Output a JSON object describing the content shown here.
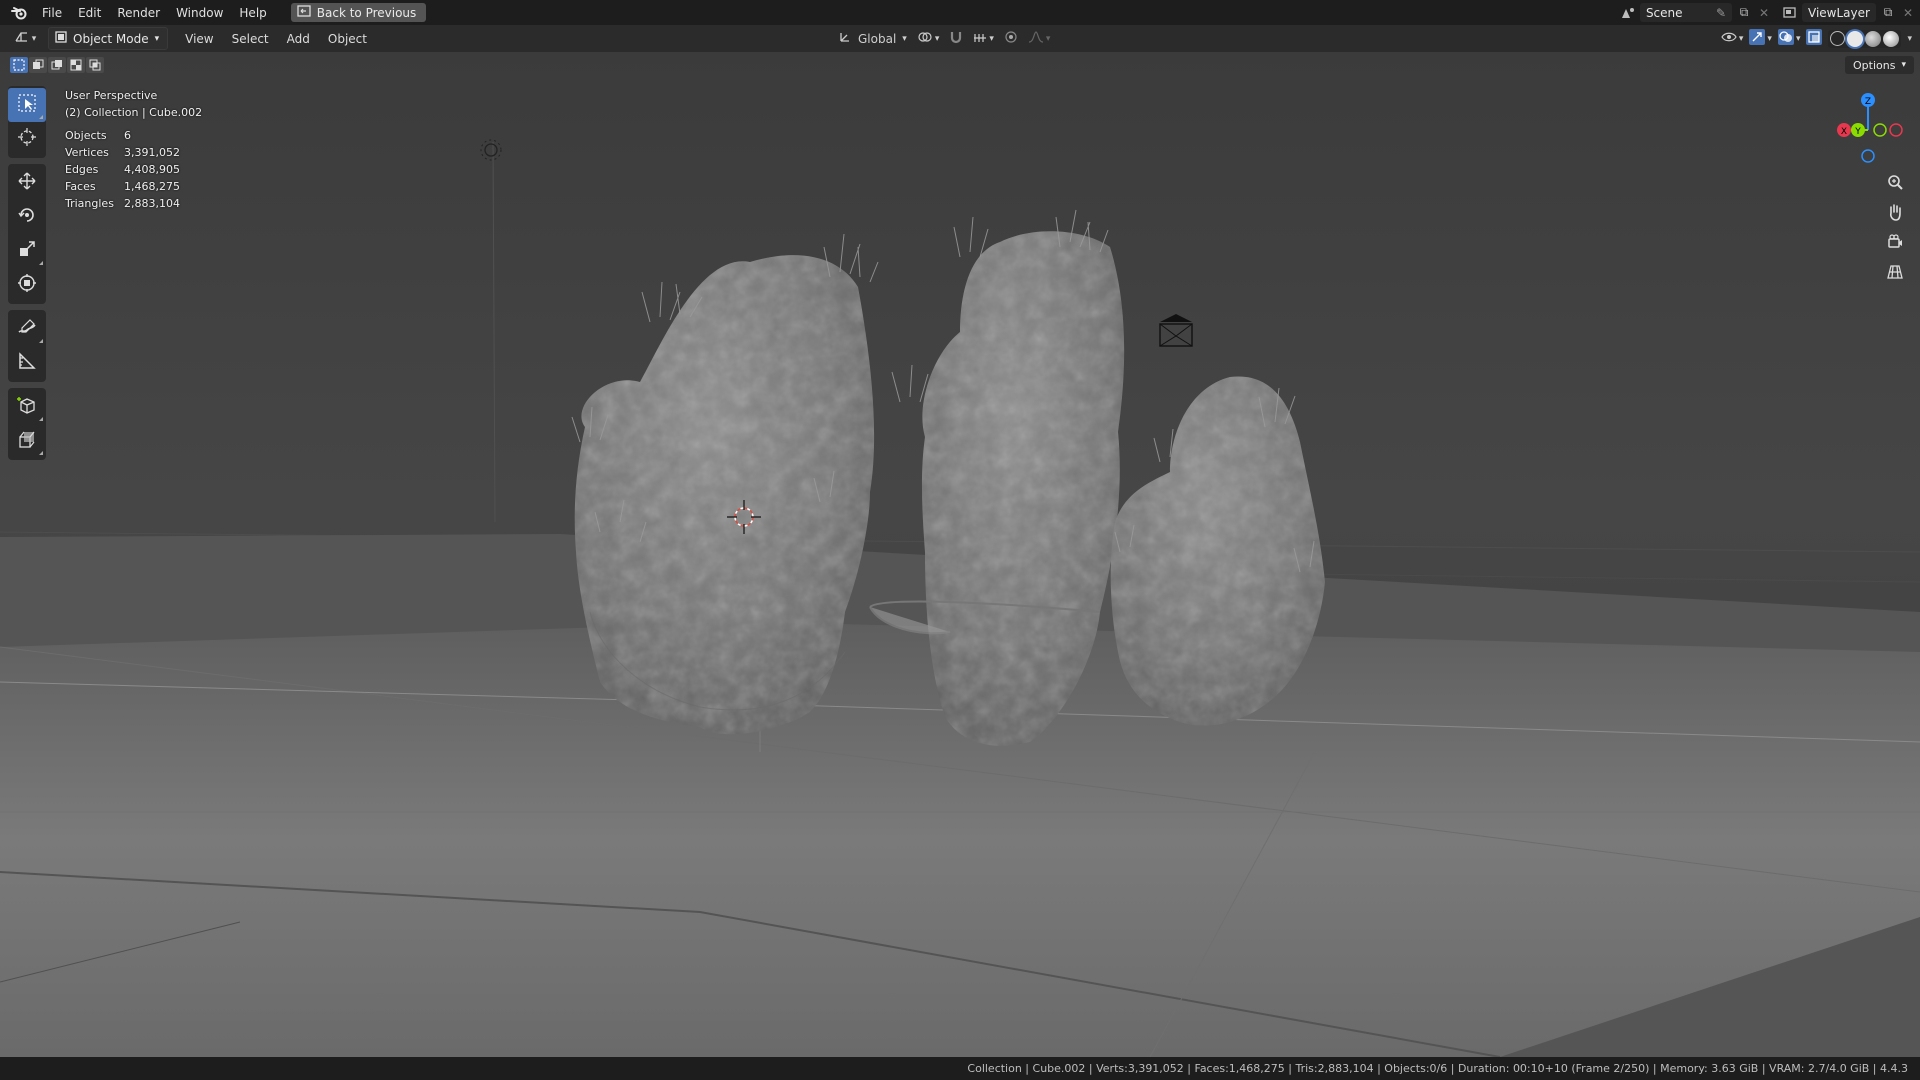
{
  "menubar": {
    "logo_icon": "blender-logo-icon",
    "items": [
      "File",
      "Edit",
      "Render",
      "Window",
      "Help"
    ],
    "back_button": "Back to Previous",
    "scene_name": "Scene",
    "view_layer": "ViewLayer"
  },
  "viewport_header": {
    "mode": "Object Mode",
    "menus": [
      "View",
      "Select",
      "Add",
      "Object"
    ],
    "transform_orientation": "Global",
    "options_label": "Options"
  },
  "overlay": {
    "view_name": "User Perspective",
    "collection_info": "(2) Collection | Cube.002",
    "stats": [
      {
        "label": "Objects",
        "value": "6"
      },
      {
        "label": "Vertices",
        "value": "3,391,052"
      },
      {
        "label": "Edges",
        "value": "4,408,905"
      },
      {
        "label": "Faces",
        "value": "1,468,275"
      },
      {
        "label": "Triangles",
        "value": "2,883,104"
      }
    ]
  },
  "gizmo": {
    "x_label": "X",
    "y_label": "Y",
    "z_label": "Z",
    "x_color": "#e8384f",
    "y_color": "#8bdc00",
    "z_color": "#2c8fff"
  },
  "toolbar": {
    "tools": [
      "select-box-icon",
      "cursor-icon",
      "move-icon",
      "rotate-icon",
      "scale-icon",
      "transform-icon",
      "annotate-icon",
      "measure-icon",
      "add-cube-icon",
      "extrude-icon"
    ]
  },
  "statusbar": {
    "text": "Collection | Cube.002 | Verts:3,391,052 | Faces:1,468,275 | Tris:2,883,104 | Objects:0/6 | Duration: 00:10+10 (Frame 2/250) | Memory: 3.63 GiB | VRAM: 2.7/4.0 GiB | 4.4.3"
  },
  "colors": {
    "accent": "#4772b3",
    "background": "#3a3a3a"
  }
}
